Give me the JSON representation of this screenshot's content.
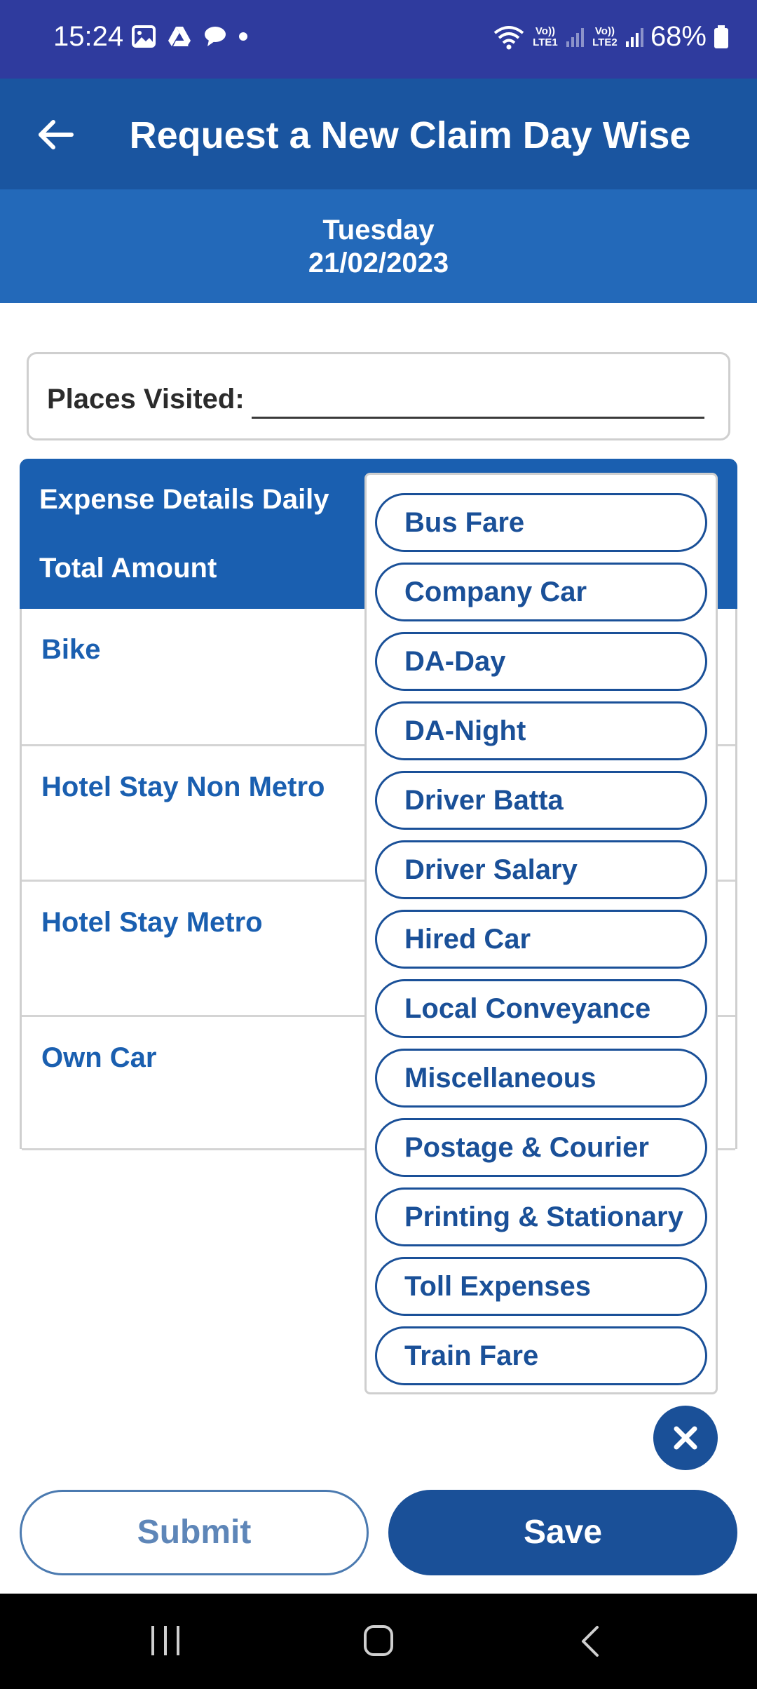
{
  "status_bar": {
    "time": "15:24",
    "sim1": "Vo)) LTE1",
    "sim2": "Vo)) LTE2",
    "battery": "68%"
  },
  "app_bar": {
    "title": "Request a New Claim Day Wise"
  },
  "date": {
    "day": "Tuesday",
    "value": "21/02/2023"
  },
  "places": {
    "label": "Places Visited:",
    "value": ""
  },
  "expense_panel": {
    "title": "Expense Details Daily",
    "total_label": "Total Amount",
    "rows": [
      "Bike",
      "Hotel Stay Non Metro",
      "Hotel Stay Metro",
      "Own Car"
    ]
  },
  "dropdown": {
    "options": [
      "Bus Fare",
      "Company Car",
      "DA-Day",
      "DA-Night",
      "Driver Batta",
      "Driver Salary",
      "Hired Car",
      "Local Conveyance",
      "Miscellaneous",
      "Postage & Courier",
      "Printing & Stationary",
      "Toll Expenses",
      "Train Fare"
    ]
  },
  "actions": {
    "submit": "Submit",
    "save": "Save"
  },
  "colors": {
    "status_bar": "#2f3b9e",
    "app_bar": "#1a55a0",
    "date_band": "#2369b9",
    "accent": "#1a5098"
  },
  "icons": {
    "back": "arrow-left-icon",
    "close": "close-icon",
    "nav_recent": "recent-apps-icon",
    "nav_home": "home-icon",
    "nav_back": "chevron-left-icon"
  }
}
